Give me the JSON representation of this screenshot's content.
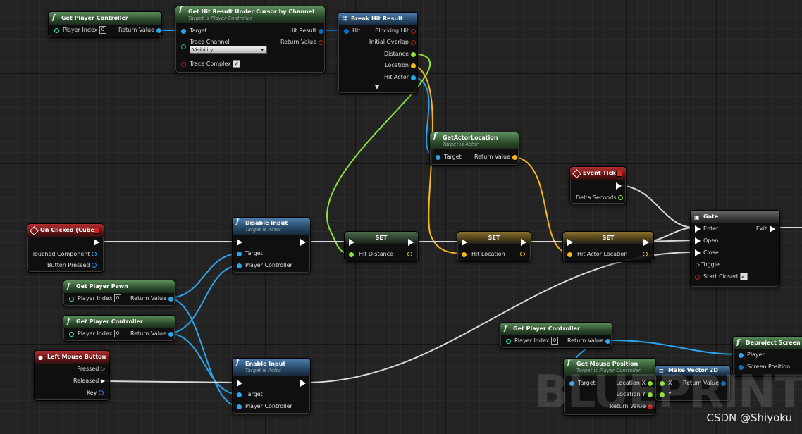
{
  "colors": {
    "object": "#2aa6ee",
    "float": "#8ee03c",
    "vector": "#f6b81f",
    "struct": "#0a6fc7",
    "bool": "#c01d1d",
    "exec": "#ffffff",
    "wire_exec": "#d8d8d8"
  },
  "nodes": {
    "get_pc_top": {
      "title": "Get Player Controller",
      "player_index": "Player Index",
      "index_value": "0",
      "return_value": "Return Value"
    },
    "hit_result": {
      "title": "Get Hit Result Under Cursor by Channel",
      "subtitle": "Target is Player Controller",
      "target": "Target",
      "trace_channel": "Trace Channel",
      "trace_value": "Visibility",
      "trace_complex": "Trace Complex",
      "hit_result": "Hit Result",
      "return_value": "Return Value"
    },
    "break_hit": {
      "title": "Break Hit Result",
      "hit": "Hit",
      "blocking_hit": "Blocking Hit",
      "initial_overlap": "Initial Overlap",
      "distance": "Distance",
      "location": "Location",
      "hit_actor": "Hit Actor",
      "expand": "▼"
    },
    "get_actor_loc": {
      "title": "GetActorLocation",
      "subtitle": "Target is Actor",
      "target": "Target",
      "return_value": "Return Value"
    },
    "event_tick": {
      "title": "Event Tick",
      "delta": "Delta Seconds"
    },
    "on_clicked": {
      "title": "On Clicked (Cube)",
      "touched": "Touched Component",
      "button": "Button Pressed"
    },
    "disable_input": {
      "title": "Disable Input",
      "subtitle": "Target is Actor",
      "target": "Target",
      "pc": "Player Controller"
    },
    "set1": {
      "title": "SET",
      "var": "Hit Distance"
    },
    "set2": {
      "title": "SET",
      "var": "Hit Location"
    },
    "set3": {
      "title": "SET",
      "var": "Hit Actor Location"
    },
    "gate": {
      "title": "Gate",
      "enter": "Enter",
      "open": "Open",
      "close": "Close",
      "toggle": "Toggle",
      "start_closed": "Start Closed",
      "exit": "Exit"
    },
    "get_pawn": {
      "title": "Get Player Pawn",
      "player_index": "Player Index",
      "index_value": "0",
      "return_value": "Return Value"
    },
    "get_pc_mid": {
      "title": "Get Player Controller",
      "player_index": "Player Index",
      "index_value": "0",
      "return_value": "Return Value"
    },
    "lmb": {
      "title": "Left Mouse Button",
      "pressed": "Pressed",
      "released": "Released",
      "key": "Key"
    },
    "enable_input": {
      "title": "Enable Input",
      "subtitle": "Target is Actor",
      "target": "Target",
      "pc": "Player Controller"
    },
    "get_pc_br": {
      "title": "Get Player Controller",
      "player_index": "Player Index",
      "index_value": "0",
      "return_value": "Return Value"
    },
    "deproject": {
      "title": "Deproject Screen to W",
      "player": "Player",
      "screen_pos": "Screen Position"
    },
    "mouse_pos": {
      "title": "Get Mouse Position",
      "subtitle": "Target is Player Controller",
      "target": "Target",
      "loc_x": "Location X",
      "loc_y": "Location Y",
      "return_value": "Return Value"
    },
    "make_vec": {
      "title": "Make Vector 2D",
      "x": "X",
      "y": "Y",
      "return_value": "Return Value"
    }
  },
  "watermark": "BLUEPRINT",
  "credit": "CSDN @Shiyoku"
}
